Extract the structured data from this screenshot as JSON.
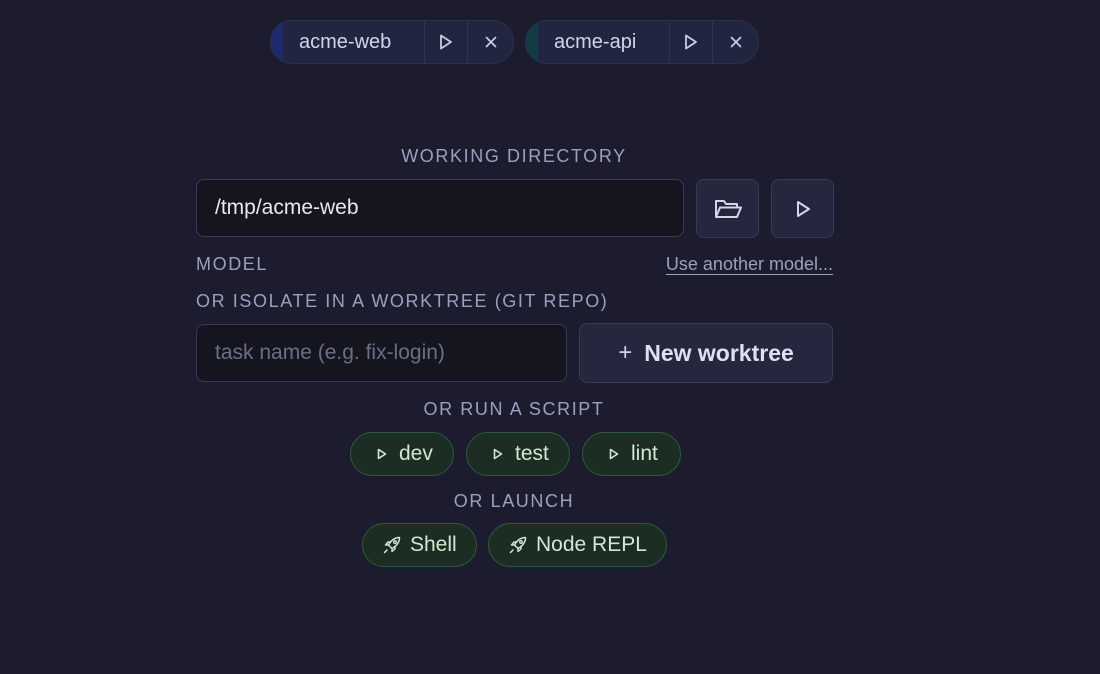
{
  "sessions": [
    {
      "name": "acme-web",
      "accent": "#1e2a6e",
      "play_icon": "play-icon",
      "close_icon": "close-icon"
    },
    {
      "name": "acme-api",
      "accent": "#123c44",
      "play_icon": "play-icon",
      "close_icon": "close-icon"
    }
  ],
  "working_directory": {
    "label": "WORKING DIRECTORY",
    "value": "/tmp/acme-web",
    "browse_icon": "folder-open-icon",
    "run_icon": "play-icon"
  },
  "model": {
    "label": "MODEL",
    "link": "Use another model..."
  },
  "worktree": {
    "label": "OR ISOLATE IN A WORKTREE (GIT REPO)",
    "placeholder": "task name (e.g. fix-login)",
    "button_icon": "plus",
    "button_label": "New worktree"
  },
  "scripts": {
    "label": "OR RUN A SCRIPT",
    "items": [
      "dev",
      "test",
      "lint"
    ]
  },
  "launch": {
    "label": "OR LAUNCH",
    "items": [
      "Shell",
      "Node REPL"
    ],
    "icon": "rocket-icon"
  },
  "colors": {
    "background": "#1c1c2e",
    "pill_green_bg": "#1c2e24",
    "pill_green_border": "#2f5a3c",
    "label": "#9aa0c0"
  }
}
